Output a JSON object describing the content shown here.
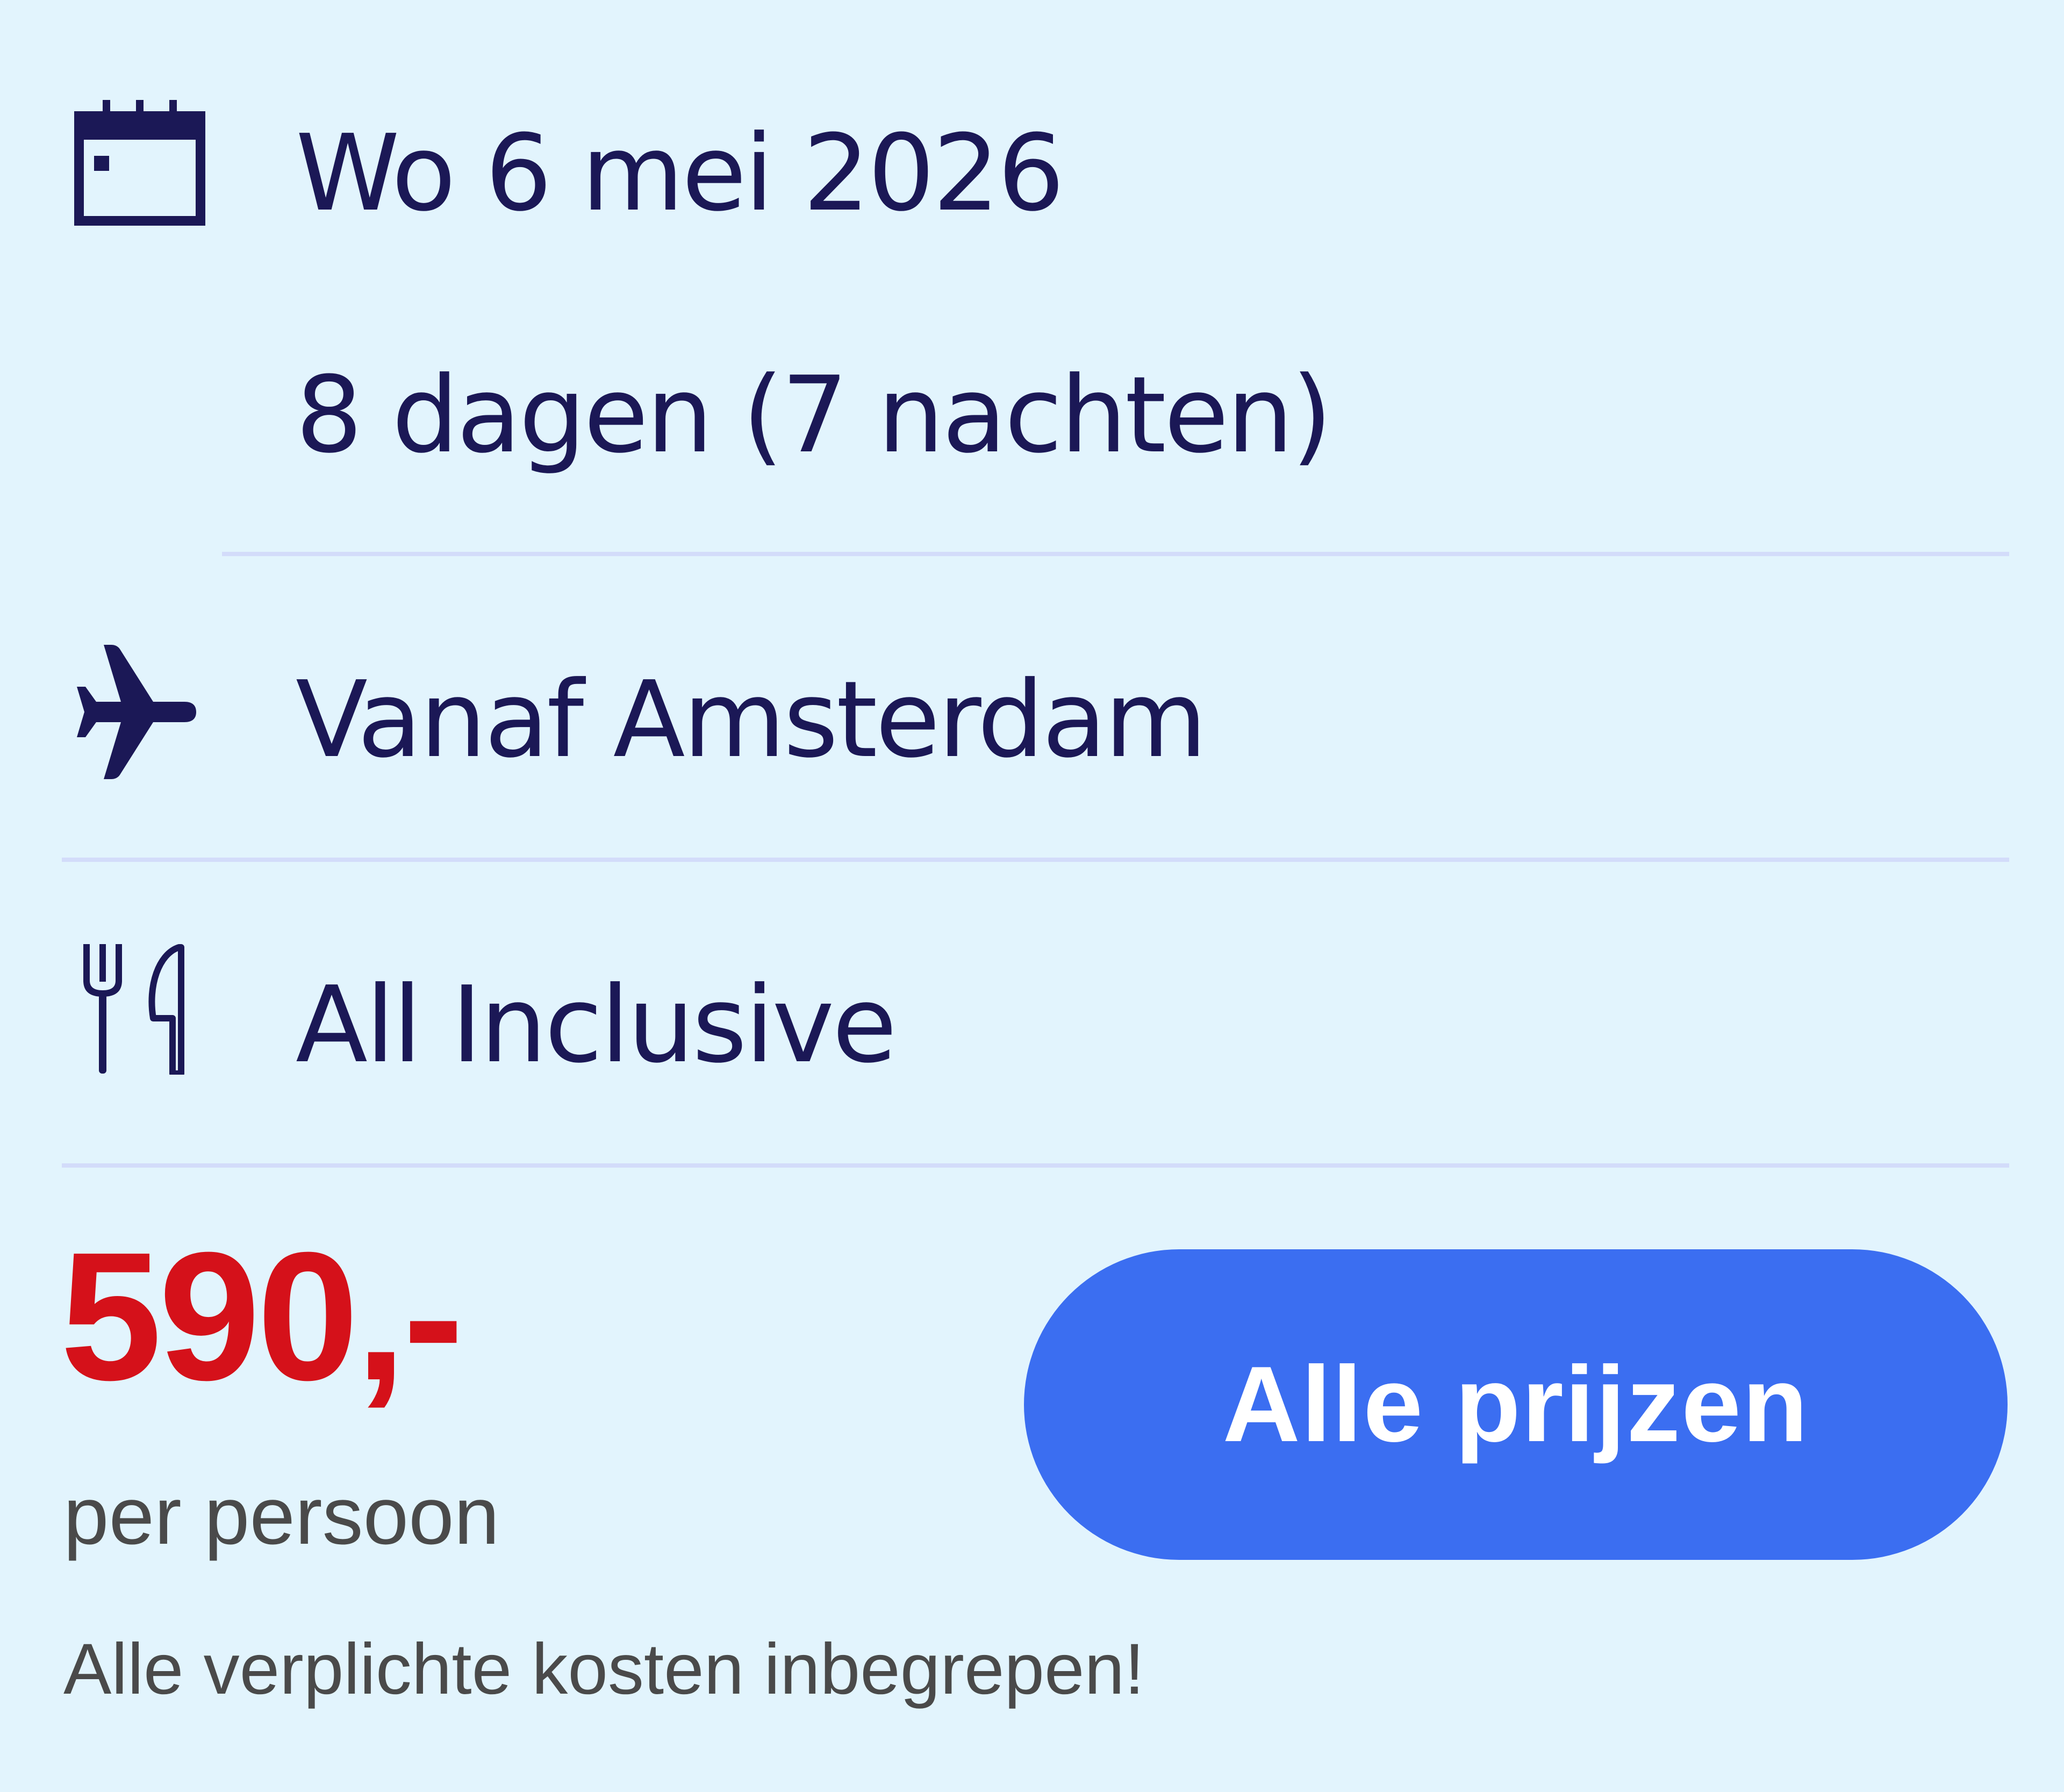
{
  "trip": {
    "date": "Wo 6 mei 2026",
    "duration": "8 dagen (7 nachten)",
    "departure": "Vanaf Amsterdam",
    "board": "All Inclusive"
  },
  "icons": {
    "date": "calendar-icon",
    "departure": "airplane-icon",
    "board": "fork-knife-icon"
  },
  "pricing": {
    "price": "590,-",
    "per_person": "per persoon",
    "note": "Alle verplichte kosten inbegrepen!",
    "button_label": "Alle prijzen"
  },
  "colors": {
    "background": "#e2f4fd",
    "text": "#1b1856",
    "price": "#d5111a",
    "button": "#3b6ef1",
    "divider": "#d3dcfa",
    "muted": "#4a4a4a"
  }
}
